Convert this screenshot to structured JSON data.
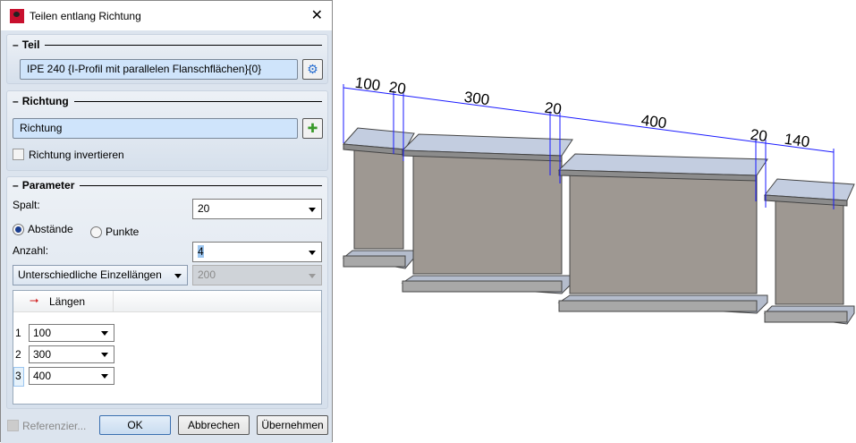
{
  "dialog": {
    "title": "Teilen entlang Richtung",
    "close": "✕"
  },
  "teil": {
    "header": "Teil",
    "value": "IPE 240 {I-Profil mit parallelen Flanschflächen}{0}",
    "icon": "gear-icon"
  },
  "richtung": {
    "header": "Richtung",
    "value": "Richtung",
    "icon": "add-direction-icon",
    "invert_label": "Richtung invertieren",
    "invert_checked": false
  },
  "parameter": {
    "header": "Parameter",
    "spalt_label": "Spalt:",
    "spalt_value": "20",
    "radio_abstaende": "Abstände",
    "radio_punkte": "Punkte",
    "selected": "Abstände",
    "anzahl_label": "Anzahl:",
    "anzahl_value": "4",
    "mode_value": "Unterschiedliche Einzellängen",
    "length_value": "200",
    "table": {
      "column": "Längen",
      "rows": [
        {
          "index": "1",
          "value": "100"
        },
        {
          "index": "2",
          "value": "300"
        },
        {
          "index": "3",
          "value": "400"
        }
      ]
    }
  },
  "footer": {
    "referenz_label": "Referenzier...",
    "ok": "OK",
    "cancel": "Abbrechen",
    "apply": "Übernehmen"
  },
  "viewport": {
    "dimensions": [
      "100",
      "20",
      "300",
      "20",
      "400",
      "20",
      "140"
    ],
    "dimension_color": "#1a1aff"
  }
}
